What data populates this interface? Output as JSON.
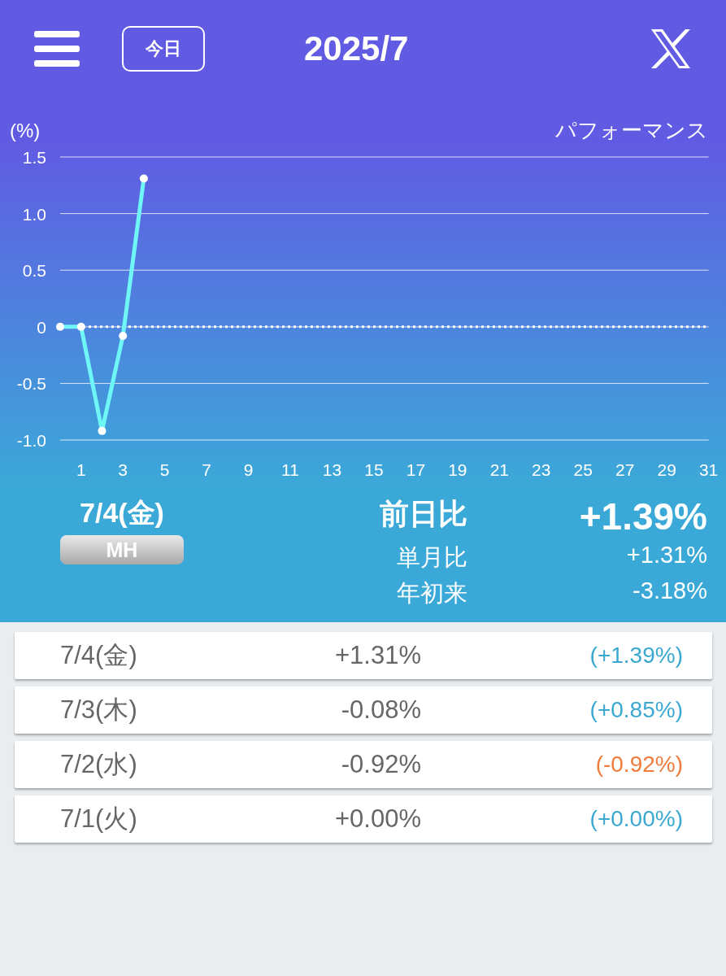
{
  "header": {
    "today_button": "今日",
    "title": "2025/7"
  },
  "chart_data": {
    "type": "line",
    "marker": "o",
    "title": "パフォーマンス",
    "grid": true,
    "ref_lines": [
      {
        "axis": "y",
        "value": 0
      }
    ],
    "ylabel": "(%)",
    "x": [
      0,
      1,
      2,
      3,
      4
    ],
    "values": [
      0,
      0,
      -0.92,
      -0.08,
      1.31
    ],
    "xlim": [
      0,
      31
    ],
    "ylim": [
      -1,
      1.5
    ],
    "xticks": [
      1,
      3,
      5,
      7,
      9,
      11,
      13,
      15,
      17,
      19,
      21,
      23,
      25,
      27,
      29,
      31
    ],
    "yticks": [
      {
        "value": 1.5,
        "label": "1.5"
      },
      {
        "value": 1,
        "label": "1.0"
      },
      {
        "value": 0.5,
        "label": "0.5"
      },
      {
        "value": 0,
        "label": "0"
      },
      {
        "value": -0.5,
        "label": "-0.5"
      },
      {
        "value": -1,
        "label": "-1.0"
      }
    ]
  },
  "summary": {
    "date": "7/4(金)",
    "badge": "MH",
    "stats": [
      {
        "label": "前日比",
        "value": "+1.39%",
        "kind": "main"
      },
      {
        "label": "単月比",
        "value": "+1.31%",
        "kind": "sub"
      },
      {
        "label": "年初来",
        "value": "-3.18%",
        "kind": "sub"
      }
    ]
  },
  "rows": [
    {
      "date": "7/4(金)",
      "value": "+1.31%",
      "change": "(+1.39%)",
      "color": "#3aa8d0"
    },
    {
      "date": "7/3(木)",
      "value": "-0.08%",
      "change": "(+0.85%)",
      "color": "#3aa8d0"
    },
    {
      "date": "7/2(水)",
      "value": "-0.92%",
      "change": "(-0.92%)",
      "color": "#ef7b3c"
    },
    {
      "date": "7/1(火)",
      "value": "+0.00%",
      "change": "(+0.00%)",
      "color": "#3aa8d0"
    }
  ]
}
